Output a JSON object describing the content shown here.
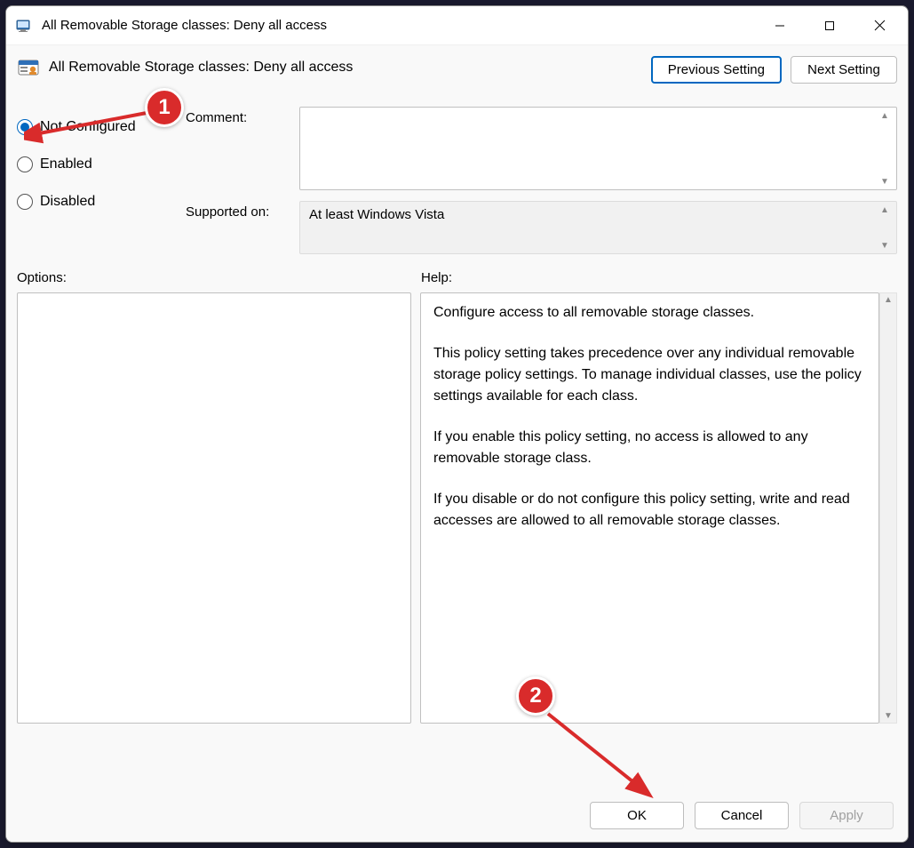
{
  "window": {
    "title": "All Removable Storage classes: Deny all access"
  },
  "header": {
    "title": "All Removable Storage classes: Deny all access",
    "prev": "Previous Setting",
    "next": "Next Setting"
  },
  "radios": {
    "not_configured": "Not Configured",
    "enabled": "Enabled",
    "disabled": "Disabled",
    "selected": "not_configured"
  },
  "fields": {
    "comment_label": "Comment:",
    "comment_value": "",
    "supported_label": "Supported on:",
    "supported_value": "At least Windows Vista"
  },
  "labels": {
    "options": "Options:",
    "help": "Help:"
  },
  "help": {
    "p1": "Configure access to all removable storage classes.",
    "p2": "This policy setting takes precedence over any individual removable storage policy settings. To manage individual classes, use the policy settings available for each class.",
    "p3": "If you enable this policy setting, no access is allowed to any removable storage class.",
    "p4": "If you disable or do not configure this policy setting, write and read accesses are allowed to all removable storage classes."
  },
  "footer": {
    "ok": "OK",
    "cancel": "Cancel",
    "apply": "Apply"
  },
  "annotations": {
    "badge1": "1",
    "badge2": "2"
  }
}
